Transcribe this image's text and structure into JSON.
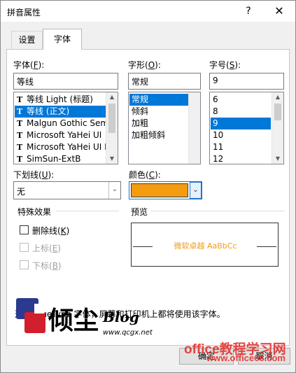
{
  "window": {
    "title": "拼音属性",
    "help_label": "?",
    "close_label": "✕"
  },
  "tabs": [
    {
      "label": "设置",
      "active": false
    },
    {
      "label": "字体",
      "active": true
    }
  ],
  "font": {
    "label": "字体(F):",
    "label_text": "字体(",
    "label_key": "F",
    "label_end": "):",
    "value": "等线",
    "items": [
      {
        "label": "等线 Light (标题)",
        "selected": false,
        "icon": "truetype-icon"
      },
      {
        "label": "等线 (正文)",
        "selected": true,
        "icon": "truetype-icon"
      },
      {
        "label": "Malgun Gothic Semi",
        "selected": false,
        "icon": "truetype-icon"
      },
      {
        "label": "Microsoft YaHei UI",
        "selected": false,
        "icon": "truetype-icon"
      },
      {
        "label": "Microsoft YaHei UI L",
        "selected": false,
        "icon": "truetype-icon"
      },
      {
        "label": "SimSun-ExtB",
        "selected": false,
        "icon": "truetype-icon"
      }
    ]
  },
  "style": {
    "label_text": "字形(",
    "label_key": "O",
    "label_end": "):",
    "value": "常规",
    "items": [
      {
        "label": "常规",
        "selected": true
      },
      {
        "label": "倾斜",
        "selected": false
      },
      {
        "label": "加粗",
        "selected": false
      },
      {
        "label": "加粗倾斜",
        "selected": false
      }
    ]
  },
  "size": {
    "label_text": "字号(",
    "label_key": "S",
    "label_end": "):",
    "value": "9",
    "items": [
      {
        "label": "6",
        "selected": false
      },
      {
        "label": "8",
        "selected": false
      },
      {
        "label": "9",
        "selected": true
      },
      {
        "label": "10",
        "selected": false
      },
      {
        "label": "11",
        "selected": false
      },
      {
        "label": "12",
        "selected": false
      }
    ]
  },
  "underline": {
    "label_text": "下划线(",
    "label_key": "U",
    "label_end": "):",
    "value": "无"
  },
  "color": {
    "label_text": "颜色(",
    "label_key": "C",
    "label_end": "):",
    "value": "#f39c12"
  },
  "effects": {
    "title": "特殊效果",
    "strikethrough": {
      "label_text": "删除线(",
      "label_key": "K",
      "label_end": ")",
      "checked": false,
      "enabled": true
    },
    "superscript": {
      "label_text": "上标(",
      "label_key": "E",
      "label_end": ")",
      "checked": false,
      "enabled": false
    },
    "subscript": {
      "label_text": "下标(",
      "label_key": "B",
      "label_end": ")",
      "checked": false,
      "enabled": false
    }
  },
  "preview": {
    "title": "预览",
    "sample": "微软卓越  AaBbCc"
  },
  "footer_text": "这是 TrueType 字体，屏幕和打印机上都将使用该字体。",
  "buttons": {
    "ok": "确定",
    "cancel": "取消"
  },
  "watermark": {
    "logo_text": "倾尘",
    "blog_text": "Blog",
    "blog_url": "www.qcgx.net",
    "site_name": "office教程学习网",
    "site_url": "www.office68.com"
  },
  "colors": {
    "accent": "#0078d7",
    "preview_text": "#f39c12",
    "watermark": "#e3342f"
  }
}
